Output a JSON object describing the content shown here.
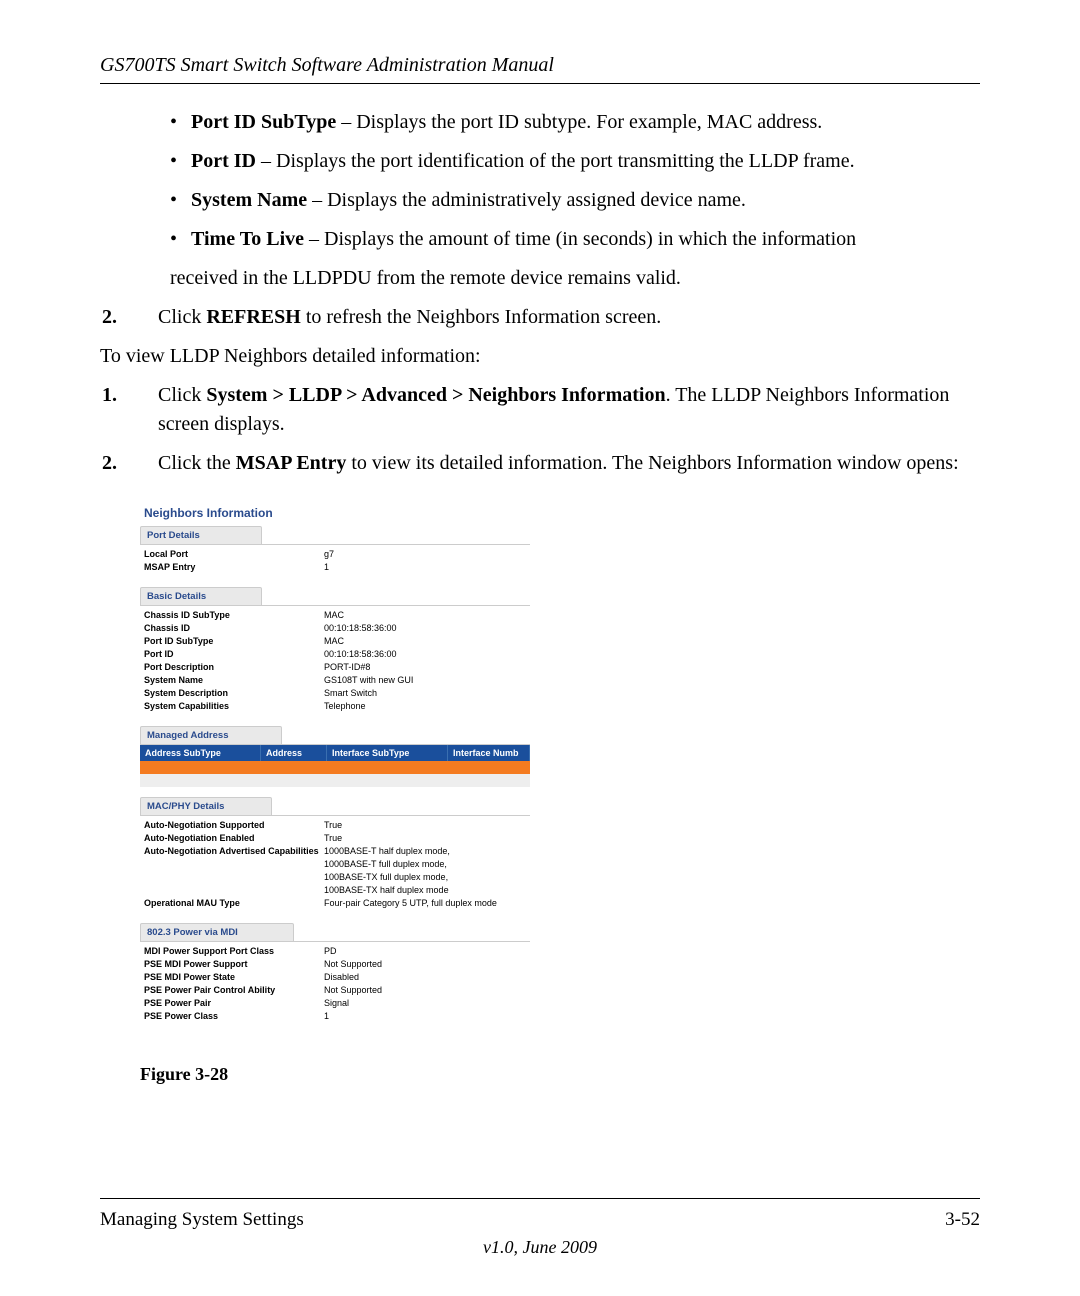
{
  "header": {
    "running_head": "GS700TS Smart Switch Software Administration Manual"
  },
  "bullets": [
    {
      "term": "Port ID SubType",
      "desc": " – Displays the port ID subtype. For example, MAC address."
    },
    {
      "term": "Port ID",
      "desc": " – Displays the port identification of the port transmitting the LLDP frame."
    },
    {
      "term": "System Name",
      "desc": " – Displays the administratively assigned device name."
    },
    {
      "term": "Time To Live",
      "desc": " – Displays the amount of time (in seconds) in which the information"
    }
  ],
  "bullet_cont": "received in the LLDPDU from the remote device remains valid.",
  "step_refresh": {
    "num": "2.",
    "pre": "Click ",
    "bold": "REFRESH",
    "post": " to refresh the Neighbors Information screen."
  },
  "para_view": "To view LLDP Neighbors detailed information:",
  "step_nav": {
    "num": "1.",
    "pre": "Click ",
    "bold": "System > LLDP > Advanced > Neighbors Information",
    "post": ". The LLDP Neighbors Information screen displays."
  },
  "step_msap": {
    "num": "2.",
    "pre": "Click the ",
    "bold": "MSAP Entry",
    "post": " to view its detailed information. The Neighbors Information window opens:"
  },
  "figure": {
    "caption": "Figure 3-28",
    "title": "Neighbors Information",
    "sections": {
      "port_details": {
        "header": "Port Details",
        "rows": [
          {
            "k": "Local Port",
            "v": "g7"
          },
          {
            "k": "MSAP Entry",
            "v": "1"
          }
        ]
      },
      "basic_details": {
        "header": "Basic Details",
        "rows": [
          {
            "k": "Chassis ID SubType",
            "v": "MAC"
          },
          {
            "k": "Chassis ID",
            "v": "00:10:18:58:36:00"
          },
          {
            "k": "Port ID SubType",
            "v": "MAC"
          },
          {
            "k": "Port ID",
            "v": "00:10:18:58:36:00"
          },
          {
            "k": "Port Description",
            "v": "PORT-ID#8"
          },
          {
            "k": "System Name",
            "v": "GS108T with new GUI"
          },
          {
            "k": "System Description",
            "v": "Smart Switch"
          },
          {
            "k": "System Capabilities",
            "v": "Telephone"
          }
        ]
      },
      "managed_address": {
        "header": "Managed Address",
        "columns": [
          "Address SubType",
          "Address",
          "Interface SubType",
          "Interface Numb"
        ]
      },
      "macphy": {
        "header": "MAC/PHY Details",
        "rows": [
          {
            "k": "Auto-Negotiation Supported",
            "v": "True"
          },
          {
            "k": "Auto-Negotiation Enabled",
            "v": "True"
          },
          {
            "k": "Auto-Negotiation Advertised Capabilities",
            "v": "1000BASE-T half duplex mode,"
          },
          {
            "k": "",
            "v": "1000BASE-T full duplex mode,"
          },
          {
            "k": "",
            "v": "100BASE-TX full duplex mode,"
          },
          {
            "k": "",
            "v": "100BASE-TX half duplex mode"
          },
          {
            "k": "Operational MAU Type",
            "v": "Four-pair Category 5 UTP, full duplex mode"
          }
        ]
      },
      "power": {
        "header": "802.3 Power via MDI",
        "rows": [
          {
            "k": "MDI Power Support Port Class",
            "v": "PD"
          },
          {
            "k": "PSE MDI Power Support",
            "v": "Not Supported"
          },
          {
            "k": "PSE MDI Power State",
            "v": "Disabled"
          },
          {
            "k": "PSE Power Pair Control Ability",
            "v": "Not Supported"
          },
          {
            "k": "PSE Power Pair",
            "v": "Signal"
          },
          {
            "k": "PSE Power Class",
            "v": "1"
          }
        ]
      }
    }
  },
  "footer": {
    "left": "Managing System Settings",
    "right": "3-52",
    "version": "v1.0, June 2009"
  }
}
